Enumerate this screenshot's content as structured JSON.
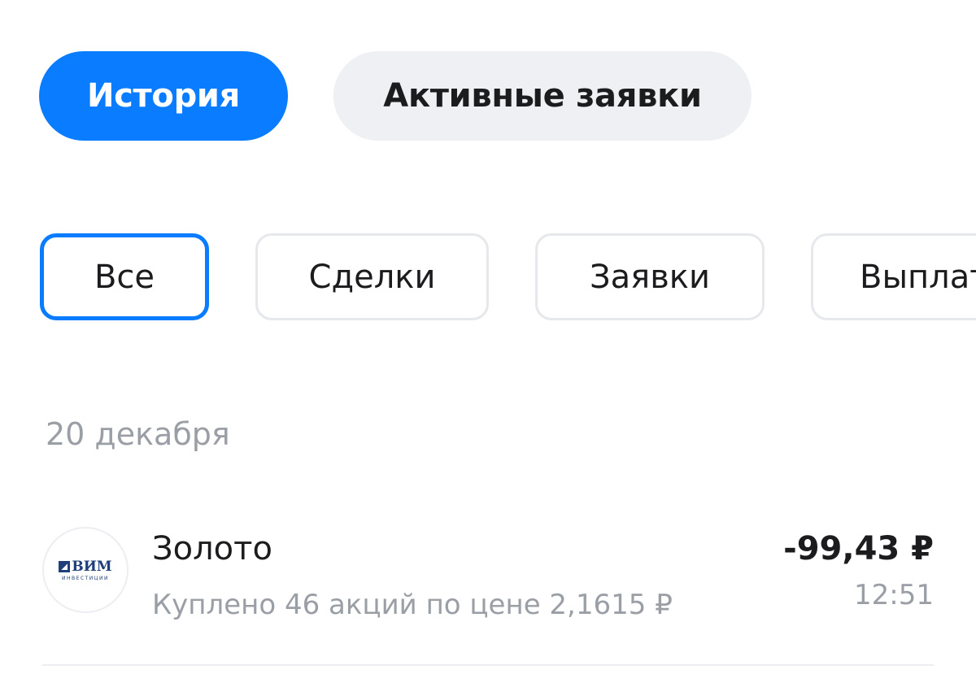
{
  "tabs": {
    "history": "История",
    "active_orders": "Активные заявки"
  },
  "filters": {
    "all": "Все",
    "deals": "Сделки",
    "orders": "Заявки",
    "payouts": "Выплаты"
  },
  "feed": {
    "date": "20 декабря",
    "operation": {
      "logo_text": "ВИМ",
      "logo_subtext": "ИНВЕСТИЦИИ",
      "logo_icon": "vim-logo-icon",
      "title": "Золото",
      "subtitle": "Куплено 46 акций по цене 2,1615 ₽",
      "amount": "-99,43 ₽",
      "time": "12:51"
    }
  },
  "colors": {
    "accent": "#0a7cff",
    "secondary_text": "#9a9ea5",
    "tab_inactive_bg": "#eef0f3",
    "logo_brand": "#1e3f7a"
  }
}
